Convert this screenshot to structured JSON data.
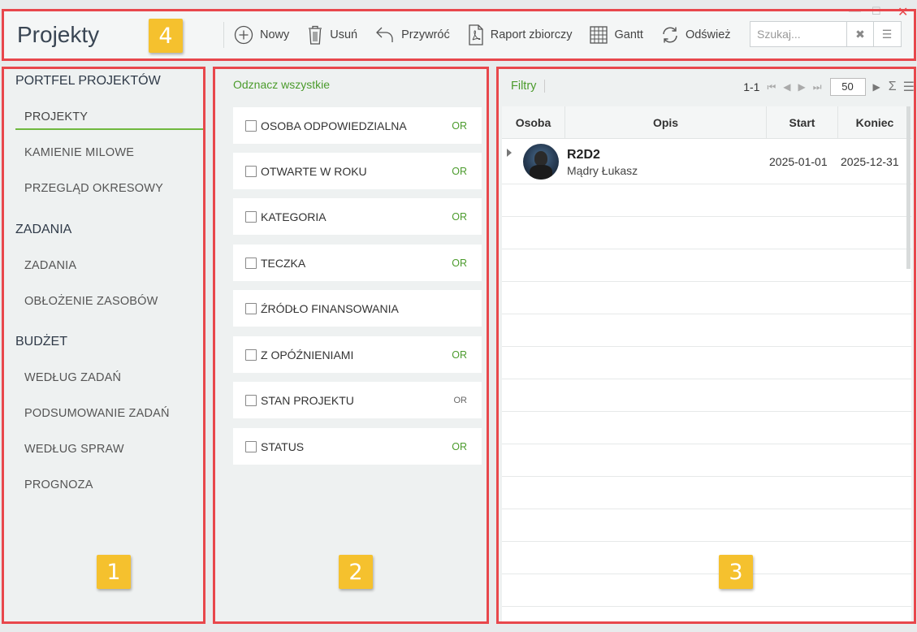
{
  "header": {
    "title": "Projekty",
    "toolbar": [
      {
        "label": "Nowy",
        "icon": "plus-circle-icon"
      },
      {
        "label": "Usuń",
        "icon": "trash-icon"
      },
      {
        "label": "Przywróć",
        "icon": "undo-icon"
      },
      {
        "label": "Raport zbiorczy",
        "icon": "pdf-icon"
      },
      {
        "label": "Gantt",
        "icon": "grid-icon"
      },
      {
        "label": "Odśwież",
        "icon": "refresh-icon"
      }
    ],
    "search_placeholder": "Szukaj..."
  },
  "badges": [
    "1",
    "2",
    "3",
    "4"
  ],
  "sidebar": {
    "sections": [
      {
        "title": "PORTFEL PROJEKTÓW",
        "items": [
          "PROJEKTY",
          "KAMIENIE MILOWE",
          "PRZEGLĄD OKRESOWY"
        ]
      },
      {
        "title": "ZADANIA",
        "items": [
          "ZADANIA",
          "OBŁOŻENIE ZASOBÓW"
        ]
      },
      {
        "title": "BUDŻET",
        "items": [
          "WEDŁUG ZADAŃ",
          "PODSUMOWANIE ZADAŃ",
          "WEDŁUG SPRAW",
          "PROGNOZA"
        ]
      }
    ],
    "active_item": "PROJEKTY"
  },
  "filters": {
    "check_all": "Odznacz wszystkie",
    "items": [
      {
        "label": "OSOBA ODPOWIEDZIALNA",
        "op": "OR"
      },
      {
        "label": "OTWARTE W ROKU",
        "op": "OR"
      },
      {
        "label": "KATEGORIA",
        "op": "OR"
      },
      {
        "label": "TECZKA",
        "op": "OR"
      },
      {
        "label": "ŹRÓDŁO FINANSOWANIA",
        "op": ""
      },
      {
        "label": "Z OPÓŹNIENIAMI",
        "op": "OR"
      },
      {
        "label": "STAN PROJEKTU",
        "op": "OR"
      },
      {
        "label": "STATUS",
        "op": "OR"
      }
    ]
  },
  "grid": {
    "filters_label": "Filtry",
    "range": "1-1",
    "page_size": "50",
    "columns": [
      "Osoba",
      "Opis",
      "Start",
      "Koniec"
    ],
    "rows": [
      {
        "name": "R2D2",
        "person": "Mądry Łukasz",
        "start": "2025-01-01",
        "end": "2025-12-31"
      }
    ]
  },
  "colors": {
    "accent": "#4b9b2c",
    "annotation_border": "#e8474c",
    "badge": "#f5c12e"
  }
}
